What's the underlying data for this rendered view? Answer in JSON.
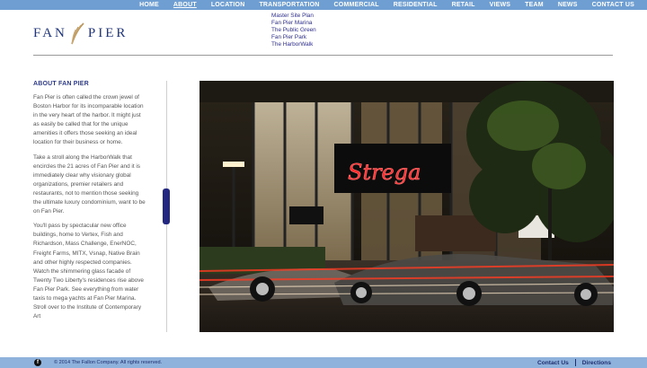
{
  "nav": {
    "items": [
      {
        "label": "HOME"
      },
      {
        "label": "ABOUT",
        "active": true
      },
      {
        "label": "LOCATION"
      },
      {
        "label": "TRANSPORTATION"
      },
      {
        "label": "COMMERCIAL"
      },
      {
        "label": "RESIDENTIAL"
      },
      {
        "label": "RETAIL"
      },
      {
        "label": "VIEWS"
      },
      {
        "label": "TEAM"
      },
      {
        "label": "NEWS"
      },
      {
        "label": "CONTACT US"
      }
    ],
    "submenu": [
      "Master Site Plan",
      "Fan Pier Marina",
      "The Public Green",
      "Fan Pier Park",
      "The HarborWalk"
    ]
  },
  "logo": {
    "left": "FAN",
    "right": "PIER"
  },
  "content": {
    "title": "ABOUT FAN PIER",
    "paragraphs": [
      "Fan Pier is often called the crown jewel of Boston Harbor for its incomparable location in the very heart of the harbor. It might just as easily be called that for the unique amenities it offers those seeking an ideal location for their business or home.",
      "Take a stroll along the HarborWalk that encircles the 21 acres of Fan Pier and it is immediately clear why visionary global organizations, premier retailers and restaurants, not to mention those seeking the ultimate luxury condominium, want to be on Fan Pier.",
      "You'll pass by spectacular new office buildings, home to Vertex, Fish and Richardson, Mass Challenge, EnerNOC, Freight Farms, MITX, Vsnap, Native Brain and other highly respected companies. Watch the shimmering glass facade of Twenty Two Liberty's residences rise above Fan Pier Park. See everything from water taxis to mega yachts at Fan Pier Marina. Stroll over to the Institute of Contemporary Art"
    ]
  },
  "hero": {
    "sign_text": "Strega"
  },
  "footer": {
    "facebook_glyph": "f",
    "copyright": "© 2014 The Fallon Company. All rights reserved.",
    "links": [
      "Contact Us",
      "Directions"
    ]
  },
  "colors": {
    "nav_bar": "#6f9fd2",
    "footer_bar": "#8fb2dc",
    "brand_blue": "#20357a",
    "accent_gold": "#b9945a"
  }
}
